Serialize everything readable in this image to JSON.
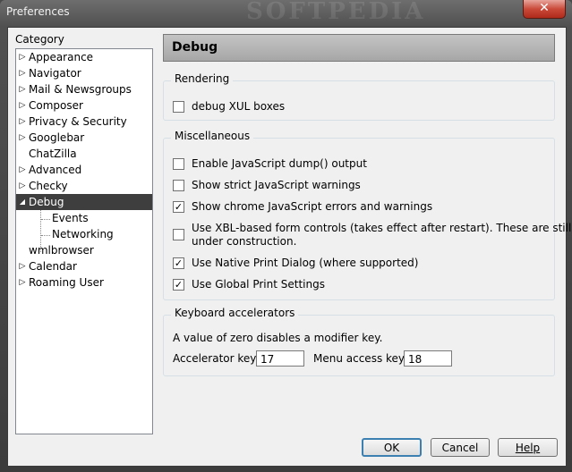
{
  "window": {
    "title": "Preferences",
    "watermark": "SOFTPEDIA",
    "close_glyph": "✕"
  },
  "sidebar": {
    "label": "Category",
    "items": [
      {
        "label": "Appearance",
        "expander": "▷"
      },
      {
        "label": "Navigator",
        "expander": "▷"
      },
      {
        "label": "Mail & Newsgroups",
        "expander": "▷"
      },
      {
        "label": "Composer",
        "expander": "▷"
      },
      {
        "label": "Privacy & Security",
        "expander": "▷"
      },
      {
        "label": "Googlebar",
        "expander": "▷"
      },
      {
        "label": "ChatZilla",
        "expander": ""
      },
      {
        "label": "Advanced",
        "expander": "▷"
      },
      {
        "label": "Checky",
        "expander": "▷"
      },
      {
        "label": "Debug",
        "expander": "◢",
        "selected": true
      },
      {
        "label": "Events",
        "expander": ""
      },
      {
        "label": "Networking",
        "expander": ""
      },
      {
        "label": "wmlbrowser",
        "expander": ""
      },
      {
        "label": "Calendar",
        "expander": "▷"
      },
      {
        "label": "Roaming User",
        "expander": "▷"
      }
    ]
  },
  "panel": {
    "title": "Debug",
    "rendering": {
      "legend": "Rendering",
      "options": [
        {
          "label": "debug XUL boxes",
          "checked": false
        }
      ]
    },
    "misc": {
      "legend": "Miscellaneous",
      "options": [
        {
          "label": "Enable JavaScript dump() output",
          "checked": false
        },
        {
          "label": "Show strict JavaScript warnings",
          "checked": false
        },
        {
          "label": "Show chrome JavaScript errors and warnings",
          "checked": true
        },
        {
          "label": "Use XBL-based form controls (takes effect after restart). These are still",
          "label2": "under construction.",
          "checked": false
        },
        {
          "label": "Use Native Print Dialog (where supported)",
          "checked": true
        },
        {
          "label": "Use Global Print Settings",
          "checked": true
        }
      ]
    },
    "keyboard": {
      "legend": "Keyboard accelerators",
      "description": "A value of zero disables a modifier key.",
      "accelerator_label": "Accelerator key:",
      "accelerator_value": "17",
      "menu_access_label": "Menu access key:",
      "menu_access_value": "18"
    }
  },
  "buttons": {
    "ok": "OK",
    "cancel": "Cancel",
    "help": "Help"
  },
  "check_glyph": "✓"
}
